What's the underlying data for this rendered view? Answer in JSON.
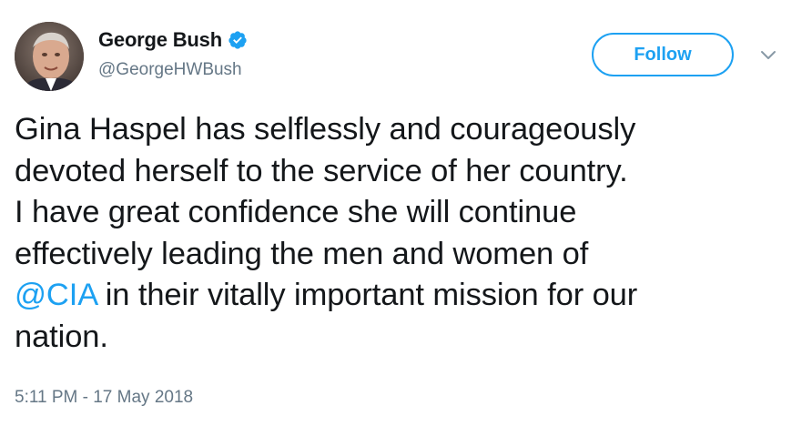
{
  "author": {
    "display_name": "George Bush",
    "handle": "@GeorgeHWBush",
    "verified": true,
    "avatar_icon": "profile-photo-icon"
  },
  "actions": {
    "follow_label": "Follow",
    "more_icon": "chevron-down-icon"
  },
  "tweet": {
    "line1": "Gina Haspel has selflessly and courageously",
    "line2": "devoted herself to the service of her country.",
    "line3": "I have great confidence she will continue",
    "line4": "effectively leading the men and women of",
    "mention": "@CIA",
    "line5_rest": " in their vitally important mission for our",
    "line6": "nation."
  },
  "timestamp": "5:11 PM - 17 May 2018",
  "colors": {
    "accent": "#1da1f2",
    "text": "#14171a",
    "secondary_text": "#657786"
  }
}
